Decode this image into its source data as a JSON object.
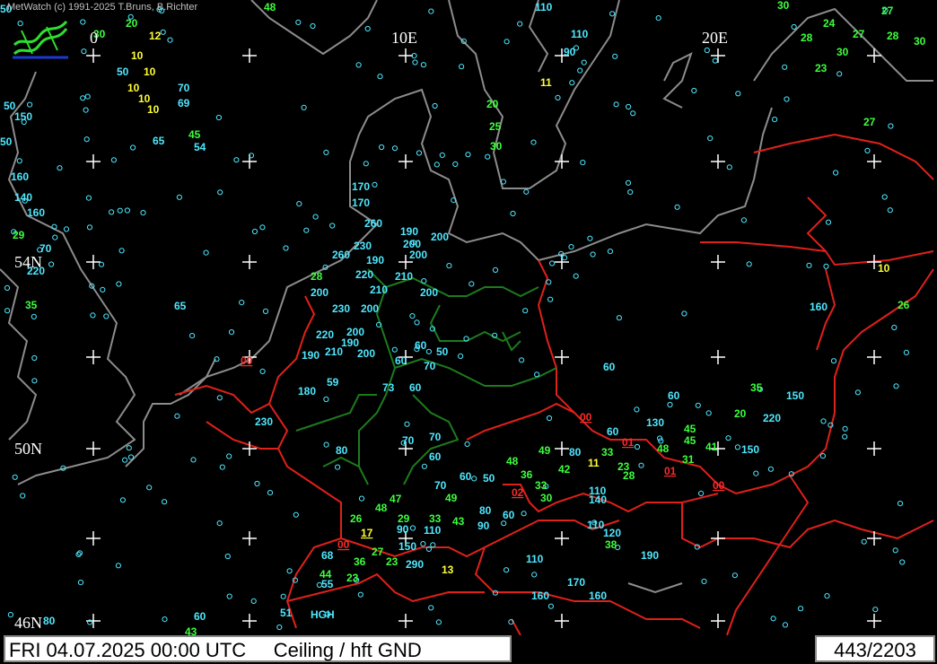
{
  "credit": "MetWatch  (c) 1991-2025 T.Bruns, B.Richter",
  "status": {
    "datetime": "FRI 04.07.2025 00:00 UTC",
    "parameter": "Ceiling / hft GND",
    "count": "443/2203"
  },
  "colors": {
    "background": "#000000",
    "coast": "#8c8c8c",
    "country_border": "#e0201a",
    "state_border": "#1d7a1d",
    "cyan_values": "#4ee8ff",
    "green_values": "#3dff3d",
    "yellow_values": "#ffff33",
    "red_values": "#ff2a2a"
  },
  "grid_labels": [
    "0",
    "10E",
    "20E",
    "54N",
    "50N",
    "46N"
  ],
  "observations": [
    {
      "t": "48",
      "c": "green"
    },
    {
      "t": "30",
      "c": "green"
    },
    {
      "t": "20",
      "c": "green"
    },
    {
      "t": "12",
      "c": "yellow"
    },
    {
      "t": "10",
      "c": "yellow"
    },
    {
      "t": "50",
      "c": "cyan"
    },
    {
      "t": "10",
      "c": "yellow"
    },
    {
      "t": "10",
      "c": "yellow"
    },
    {
      "t": "10",
      "c": "yellow"
    },
    {
      "t": "10",
      "c": "yellow"
    },
    {
      "t": "70",
      "c": "cyan"
    },
    {
      "t": "69",
      "c": "cyan"
    },
    {
      "t": "50",
      "c": "cyan"
    },
    {
      "t": "150",
      "c": "cyan"
    },
    {
      "t": "65",
      "c": "cyan"
    },
    {
      "t": "45",
      "c": "green"
    },
    {
      "t": "54",
      "c": "cyan"
    },
    {
      "t": "110",
      "c": "cyan"
    },
    {
      "t": "110",
      "c": "cyan"
    },
    {
      "t": "90",
      "c": "cyan"
    },
    {
      "t": "11",
      "c": "yellow"
    },
    {
      "t": "20",
      "c": "green"
    },
    {
      "t": "25",
      "c": "green"
    },
    {
      "t": "30",
      "c": "green"
    },
    {
      "t": "30",
      "c": "green"
    },
    {
      "t": "28",
      "c": "green"
    },
    {
      "t": "24",
      "c": "green"
    },
    {
      "t": "27",
      "c": "green"
    },
    {
      "t": "27",
      "c": "green"
    },
    {
      "t": "28",
      "c": "green"
    },
    {
      "t": "30",
      "c": "green"
    },
    {
      "t": "30",
      "c": "green"
    },
    {
      "t": "23",
      "c": "green"
    },
    {
      "t": "27",
      "c": "green"
    },
    {
      "t": "160",
      "c": "cyan"
    },
    {
      "t": "140",
      "c": "cyan"
    },
    {
      "t": "160",
      "c": "cyan"
    },
    {
      "t": "29",
      "c": "green"
    },
    {
      "t": "70",
      "c": "cyan"
    },
    {
      "t": "220",
      "c": "cyan"
    },
    {
      "t": "35",
      "c": "green"
    },
    {
      "t": "65",
      "c": "cyan"
    },
    {
      "t": "170",
      "c": "cyan"
    },
    {
      "t": "170",
      "c": "cyan"
    },
    {
      "t": "260",
      "c": "cyan"
    },
    {
      "t": "190",
      "c": "cyan"
    },
    {
      "t": "200",
      "c": "cyan"
    },
    {
      "t": "200",
      "c": "cyan"
    },
    {
      "t": "230",
      "c": "cyan"
    },
    {
      "t": "260",
      "c": "cyan"
    },
    {
      "t": "190",
      "c": "cyan"
    },
    {
      "t": "200",
      "c": "cyan"
    },
    {
      "t": "220",
      "c": "cyan"
    },
    {
      "t": "210",
      "c": "cyan"
    },
    {
      "t": "28",
      "c": "green"
    },
    {
      "t": "200",
      "c": "cyan"
    },
    {
      "t": "210",
      "c": "cyan"
    },
    {
      "t": "200",
      "c": "cyan"
    },
    {
      "t": "230",
      "c": "cyan"
    },
    {
      "t": "200",
      "c": "cyan"
    },
    {
      "t": "220",
      "c": "cyan"
    },
    {
      "t": "200",
      "c": "cyan"
    },
    {
      "t": "190",
      "c": "cyan"
    },
    {
      "t": "210",
      "c": "cyan"
    },
    {
      "t": "190",
      "c": "cyan"
    },
    {
      "t": "200",
      "c": "cyan"
    },
    {
      "t": "60",
      "c": "cyan"
    },
    {
      "t": "50",
      "c": "cyan"
    },
    {
      "t": "60",
      "c": "cyan"
    },
    {
      "t": "70",
      "c": "cyan"
    },
    {
      "t": "00",
      "c": "red"
    },
    {
      "t": "180",
      "c": "cyan"
    },
    {
      "t": "59",
      "c": "cyan"
    },
    {
      "t": "73",
      "c": "cyan"
    },
    {
      "t": "60",
      "c": "cyan"
    },
    {
      "t": "230",
      "c": "cyan"
    },
    {
      "t": "10",
      "c": "yellow"
    },
    {
      "t": "26",
      "c": "green"
    },
    {
      "t": "160",
      "c": "cyan"
    },
    {
      "t": "60",
      "c": "cyan"
    },
    {
      "t": "60",
      "c": "cyan"
    },
    {
      "t": "35",
      "c": "green"
    },
    {
      "t": "150",
      "c": "cyan"
    },
    {
      "t": "20",
      "c": "green"
    },
    {
      "t": "220",
      "c": "cyan"
    },
    {
      "t": "00",
      "c": "red"
    },
    {
      "t": "130",
      "c": "cyan"
    },
    {
      "t": "45",
      "c": "green"
    },
    {
      "t": "45",
      "c": "green"
    },
    {
      "t": "60",
      "c": "cyan"
    },
    {
      "t": "01",
      "c": "red"
    },
    {
      "t": "48",
      "c": "green"
    },
    {
      "t": "41",
      "c": "green"
    },
    {
      "t": "150",
      "c": "cyan"
    },
    {
      "t": "31",
      "c": "green"
    },
    {
      "t": "01",
      "c": "red"
    },
    {
      "t": "00",
      "c": "red"
    },
    {
      "t": "80",
      "c": "cyan"
    },
    {
      "t": "70",
      "c": "cyan"
    },
    {
      "t": "70",
      "c": "cyan"
    },
    {
      "t": "60",
      "c": "cyan"
    },
    {
      "t": "49",
      "c": "green"
    },
    {
      "t": "80",
      "c": "cyan"
    },
    {
      "t": "33",
      "c": "green"
    },
    {
      "t": "11",
      "c": "yellow"
    },
    {
      "t": "23",
      "c": "green"
    },
    {
      "t": "28",
      "c": "green"
    },
    {
      "t": "48",
      "c": "green"
    },
    {
      "t": "42",
      "c": "green"
    },
    {
      "t": "36",
      "c": "green"
    },
    {
      "t": "33",
      "c": "green"
    },
    {
      "t": "30",
      "c": "green"
    },
    {
      "t": "60",
      "c": "cyan"
    },
    {
      "t": "50",
      "c": "cyan"
    },
    {
      "t": "70",
      "c": "cyan"
    },
    {
      "t": "49",
      "c": "green"
    },
    {
      "t": "02",
      "c": "red"
    },
    {
      "t": "110",
      "c": "cyan"
    },
    {
      "t": "140",
      "c": "cyan"
    },
    {
      "t": "47",
      "c": "green"
    },
    {
      "t": "48",
      "c": "green"
    },
    {
      "t": "80",
      "c": "cyan"
    },
    {
      "t": "60",
      "c": "cyan"
    },
    {
      "t": "90",
      "c": "cyan"
    },
    {
      "t": "26",
      "c": "green"
    },
    {
      "t": "17",
      "c": "yellow"
    },
    {
      "t": "29",
      "c": "green"
    },
    {
      "t": "33",
      "c": "green"
    },
    {
      "t": "43",
      "c": "green"
    },
    {
      "t": "90",
      "c": "cyan"
    },
    {
      "t": "110",
      "c": "cyan"
    },
    {
      "t": "110",
      "c": "cyan"
    },
    {
      "t": "120",
      "c": "cyan"
    },
    {
      "t": "38",
      "c": "green"
    },
    {
      "t": "00",
      "c": "red"
    },
    {
      "t": "150",
      "c": "cyan"
    },
    {
      "t": "68",
      "c": "cyan"
    },
    {
      "t": "27",
      "c": "green"
    },
    {
      "t": "36",
      "c": "green"
    },
    {
      "t": "23",
      "c": "green"
    },
    {
      "t": "290",
      "c": "cyan"
    },
    {
      "t": "13",
      "c": "yellow"
    },
    {
      "t": "190",
      "c": "cyan"
    },
    {
      "t": "110",
      "c": "cyan"
    },
    {
      "t": "44",
      "c": "green"
    },
    {
      "t": "55",
      "c": "cyan"
    },
    {
      "t": "23",
      "c": "green"
    },
    {
      "t": "170",
      "c": "cyan"
    },
    {
      "t": "160",
      "c": "cyan"
    },
    {
      "t": "160",
      "c": "cyan"
    },
    {
      "t": "51",
      "c": "cyan"
    },
    {
      "t": "HGH",
      "c": "cyan"
    },
    {
      "t": "60",
      "c": "cyan"
    },
    {
      "t": "43",
      "c": "green"
    },
    {
      "t": "80",
      "c": "cyan"
    },
    {
      "t": "50",
      "c": "cyan"
    },
    {
      "t": "50",
      "c": "cyan"
    },
    {
      "t": "60",
      "c": "cyan"
    }
  ]
}
